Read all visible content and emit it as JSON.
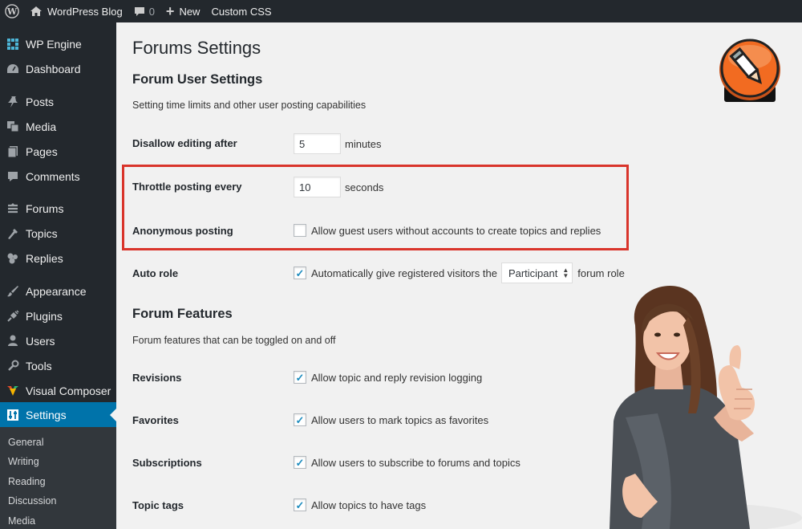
{
  "adminbar": {
    "site_name": "WordPress Blog",
    "comments_count": "0",
    "new_label": "New",
    "custom_css_label": "Custom CSS"
  },
  "sidebar": {
    "items": [
      {
        "label": "WP Engine",
        "icon": "grid-icon"
      },
      {
        "label": "Dashboard",
        "icon": "dashboard-icon"
      },
      {
        "label": "Posts",
        "icon": "pin-icon"
      },
      {
        "label": "Media",
        "icon": "media-icon"
      },
      {
        "label": "Pages",
        "icon": "pages-icon"
      },
      {
        "label": "Comments",
        "icon": "comment-icon"
      },
      {
        "label": "Forums",
        "icon": "forums-icon"
      },
      {
        "label": "Topics",
        "icon": "topics-icon"
      },
      {
        "label": "Replies",
        "icon": "replies-icon"
      },
      {
        "label": "Appearance",
        "icon": "brush-icon"
      },
      {
        "label": "Plugins",
        "icon": "plug-icon"
      },
      {
        "label": "Users",
        "icon": "user-icon"
      },
      {
        "label": "Tools",
        "icon": "wrench-icon"
      },
      {
        "label": "Visual Composer",
        "icon": "vc-icon"
      },
      {
        "label": "Settings",
        "icon": "settings-icon",
        "active": true
      }
    ],
    "submenu": [
      "General",
      "Writing",
      "Reading",
      "Discussion",
      "Media"
    ]
  },
  "page": {
    "title": "Forums Settings",
    "user_settings": {
      "title": "Forum User Settings",
      "description": "Setting time limits and other user posting capabilities",
      "disallow_editing": {
        "label": "Disallow editing after",
        "value": "5",
        "unit": "minutes"
      },
      "throttle": {
        "label": "Throttle posting every",
        "value": "10",
        "unit": "seconds"
      },
      "anonymous": {
        "label": "Anonymous posting",
        "checked": false,
        "text": "Allow guest users without accounts to create topics and replies"
      },
      "auto_role": {
        "label": "Auto role",
        "checked": true,
        "text_before": "Automatically give registered visitors the",
        "select_value": "Participant",
        "text_after": "forum role"
      }
    },
    "features": {
      "title": "Forum Features",
      "description": "Forum features that can be toggled on and off",
      "rows": [
        {
          "label": "Revisions",
          "checked": true,
          "text": "Allow topic and reply revision logging"
        },
        {
          "label": "Favorites",
          "checked": true,
          "text": "Allow users to mark topics as favorites"
        },
        {
          "label": "Subscriptions",
          "checked": true,
          "text": "Allow users to subscribe to forums and topics"
        },
        {
          "label": "Topic tags",
          "checked": true,
          "text": "Allow topics to have tags"
        }
      ]
    }
  },
  "colors": {
    "adminbar_bg": "#23282d",
    "active_menu": "#0073aa",
    "highlight_border": "#d9342b",
    "checkbox_tick": "#1e8cbe",
    "badge_orange": "#f26b21"
  }
}
